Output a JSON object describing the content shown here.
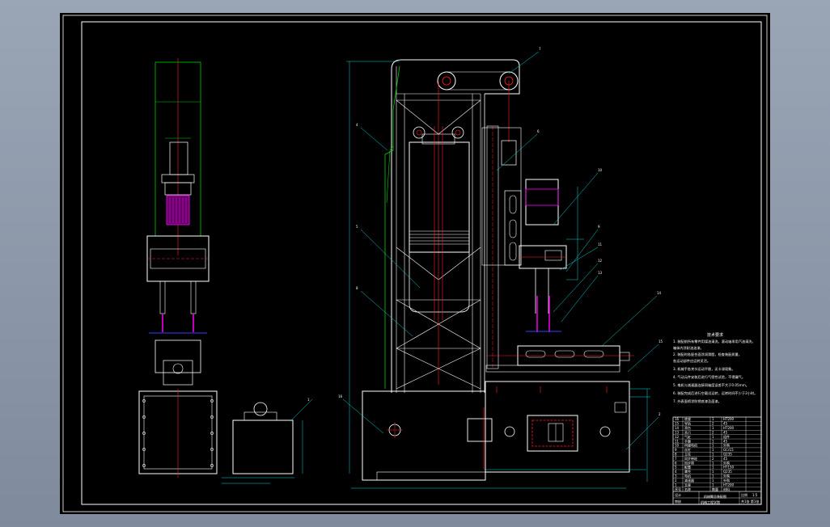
{
  "drawing": {
    "title": "机械臂总装配图",
    "technical_requirements": {
      "title": "技术要求",
      "lines": [
        "1. 装配前所有零件用煤油清洗，滚动轴承用汽油清洗，",
        "   箱体内涂耐油油漆。",
        "2. 装配时各配合面涂润滑脂，检查装配质量，",
        "   各运动部件应运转灵活。",
        "3. 机械手各关节运动平稳，无卡滞现象。",
        "4. 气动元件安装后进行气密性试验，不得漏气。",
        "5. 电机与减速器连接同轴度误差不大于0.05mm。",
        "6. 装配完成后进行空载试运转，运转时间不少于2小时。",
        "7. 外表面喷涂防锈底漆及面漆。"
      ]
    },
    "callouts": [
      "1",
      "2",
      "3",
      "4",
      "5",
      "6",
      "7",
      "8",
      "9",
      "10",
      "11",
      "12",
      "13",
      "14",
      "15",
      "16"
    ],
    "title_block": {
      "rows": [
        [
          "16",
          "底座",
          "1",
          "HT200"
        ],
        [
          "15",
          "导轨",
          "2",
          "45"
        ],
        [
          "14",
          "滑台",
          "1",
          "HT200"
        ],
        [
          "13",
          "夹爪",
          "2",
          "45"
        ],
        [
          "12",
          "气缸",
          "1",
          "组件"
        ],
        [
          "11",
          "手腕",
          "1",
          "45"
        ],
        [
          "10",
          "伺服电机",
          "1",
          "外购"
        ],
        [
          "9",
          "丝杠",
          "1",
          "GCr15"
        ],
        [
          "8",
          "立柱",
          "1",
          "Q235"
        ],
        [
          "7",
          "同步带轮",
          "2",
          "45"
        ],
        [
          "6",
          "同步带",
          "1",
          "外购"
        ],
        [
          "5",
          "配重",
          "1",
          "HT150"
        ],
        [
          "4",
          "罩壳",
          "1",
          "Q235"
        ],
        [
          "3",
          "电机",
          "1",
          "外购"
        ],
        [
          "2",
          "减速器",
          "1",
          "外购"
        ],
        [
          "1",
          "支座",
          "1",
          "HT200"
        ]
      ],
      "header": [
        "序号",
        "名称",
        "数量",
        "材料"
      ],
      "designer_label": "设计",
      "checker_label": "审核",
      "scale_label": "比例",
      "scale_value": "1:5",
      "sheet_label": "共1张 第1张",
      "school": "机械工程学院"
    }
  },
  "colors": {
    "frame": "#ffffff",
    "outline": "#ffffff",
    "green": "#00d000",
    "red": "#ff2020",
    "cyan": "#00d8d8",
    "magenta": "#ff00ff",
    "yellow": "#ffff00",
    "blue": "#3040ff"
  }
}
